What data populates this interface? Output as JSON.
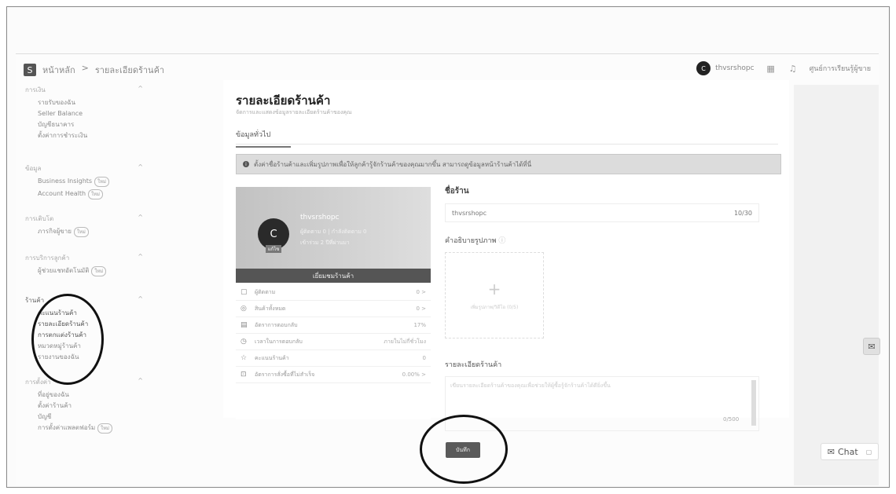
{
  "header": {
    "logo_letter": "S",
    "breadcrumb": [
      "หน้าหลัก",
      ">",
      "รายละเอียดร้านค้า"
    ],
    "username": "thvsrshopc",
    "avatar_letter": "C",
    "help_center": "ศูนย์การเรียนรู้ผู้ขาย"
  },
  "sidebar": {
    "groups": [
      {
        "title": "การเงิน",
        "items": [
          {
            "label": "รายรับของฉัน"
          },
          {
            "label": "Seller Balance"
          },
          {
            "label": "บัญชีธนาคาร"
          },
          {
            "label": "ตั้งค่าการชำระเงิน"
          }
        ]
      },
      {
        "title": "ข้อมูล",
        "items": [
          {
            "label": "Business Insights",
            "badge": "ใหม่"
          },
          {
            "label": "Account Health",
            "badge": "ใหม่"
          }
        ]
      },
      {
        "title": "การเติบโต",
        "items": [
          {
            "label": "ภารกิจผู้ขาย",
            "badge": "ใหม่"
          }
        ]
      },
      {
        "title": "การบริการลูกค้า",
        "items": [
          {
            "label": "ผู้ช่วยแชทอัตโนมัติ",
            "badge": "ใหม่"
          }
        ]
      },
      {
        "title": "ร้านค้า",
        "items": [
          {
            "label": "คะแนนร้านค้า"
          },
          {
            "label": "รายละเอียดร้านค้า"
          },
          {
            "label": "การตกแต่งร้านค้า"
          },
          {
            "label": "หมวดหมู่ร้านค้า"
          },
          {
            "label": "รายงานของฉัน"
          }
        ]
      },
      {
        "title": "การตั้งค่า",
        "items": [
          {
            "label": "ที่อยู่ของฉัน"
          },
          {
            "label": "ตั้งค่าร้านค้า"
          },
          {
            "label": "บัญชี"
          },
          {
            "label": "การตั้งค่าแพลตฟอร์ม",
            "badge": "ใหม่"
          }
        ]
      }
    ]
  },
  "main": {
    "title": "รายละเอียดร้านค้า",
    "subtitle": "จัดการและแสดงข้อมูลรายละเอียดร้านค้าของคุณ",
    "tab": "ข้อมูลทั่วไป",
    "notice": "ตั้งค่าชื่อร้านค้าและเพิ่มรูปภาพเพื่อให้ลูกค้ารู้จักร้านค้าของคุณมากขึ้น สามารถดูข้อมูลหน้าร้านค้าได้ที่นี่",
    "card": {
      "avatar_letter": "C",
      "avatar_tag": "แก้ไข",
      "shop_name": "thvsrshopc",
      "line1": "ผู้ติดตาม 0 | กำลังติดตาม 0",
      "line2": "เข้าร่วม 2 ปีที่ผ่านมา",
      "button": "เยี่ยมชมร้านค้า",
      "rows": [
        {
          "icon": "▢",
          "label": "ผู้ติดตาม",
          "value": "0 >"
        },
        {
          "icon": "◎",
          "label": "สินค้าทั้งหมด",
          "value": "0 >"
        },
        {
          "icon": "▤",
          "label": "อัตราการตอบกลับ",
          "value": "17%"
        },
        {
          "icon": "◷",
          "label": "เวลาในการตอบกลับ",
          "value": "ภายในไม่กี่ชั่วโมง"
        },
        {
          "icon": "☆",
          "label": "คะแนนร้านค้า",
          "value": "0"
        },
        {
          "icon": "⊡",
          "label": "อัตราการสั่งซื้อที่ไม่สำเร็จ",
          "value": "0.00% >"
        }
      ]
    },
    "form": {
      "name_label": "ชื่อร้าน",
      "name_value": "thvsrshopc",
      "name_count": "10/30",
      "image_label": "คำอธิบายรูปภาพ",
      "upload_text": "เพิ่มรูปภาพ/วิดีโอ (0/5)",
      "desc_label": "รายละเอียดร้านค้า",
      "desc_placeholder": "เขียนรายละเอียดร้านค้าของคุณเพื่อช่วยให้ผู้ซื้อรู้จักร้านค้าได้ดียิ่งขึ้น",
      "desc_count": "0/500"
    },
    "save_label": "บันทึก"
  },
  "chat": {
    "label": "Chat"
  }
}
